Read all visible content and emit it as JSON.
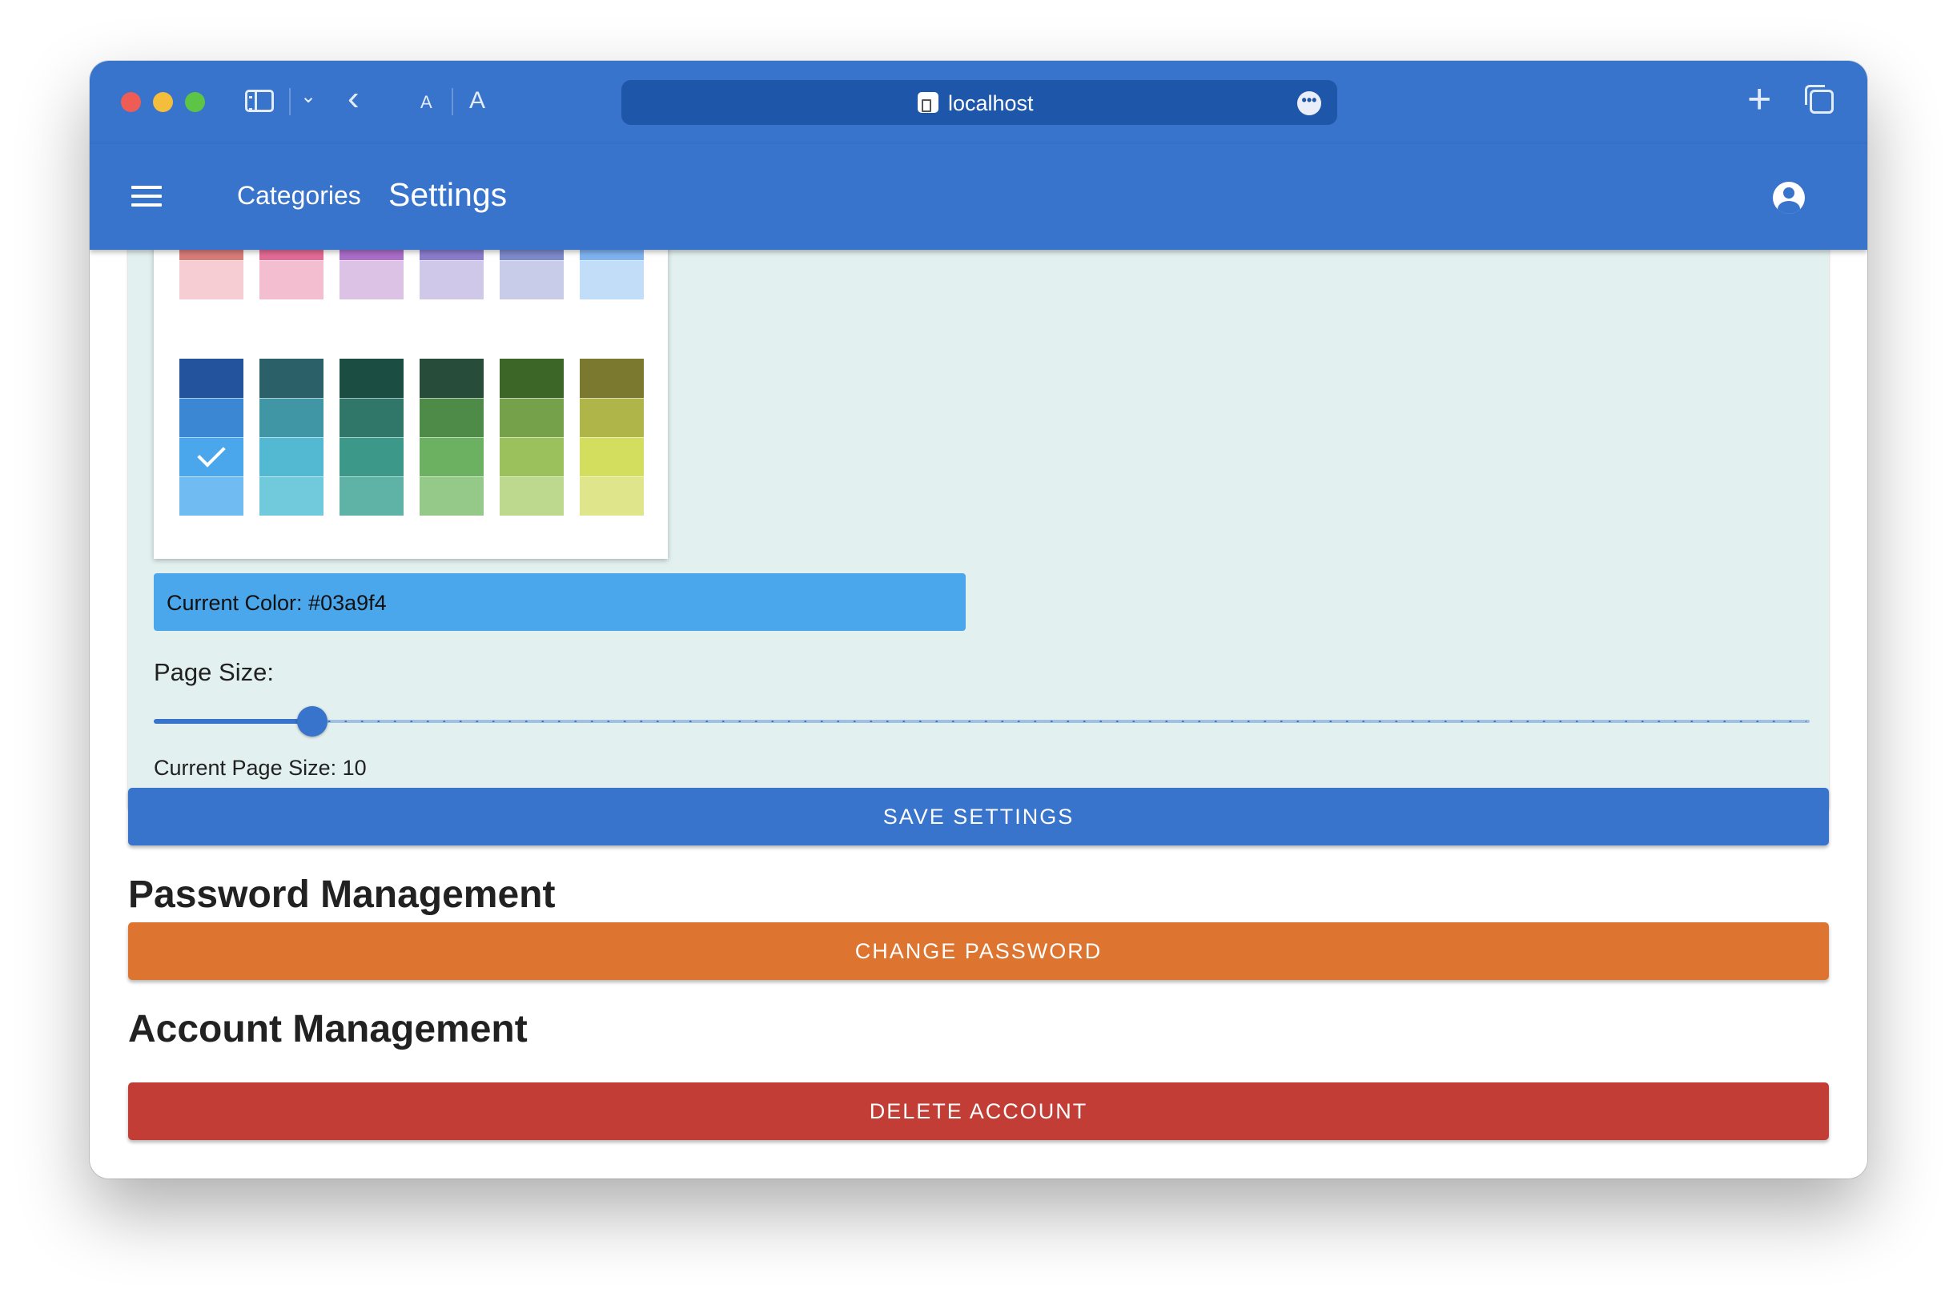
{
  "browser": {
    "address": "localhost",
    "font_small": "A",
    "font_large": "A",
    "more": "•••"
  },
  "app_bar": {
    "nav_categories": "Categories",
    "nav_settings": "Settings"
  },
  "settings": {
    "current_color_label": "Current Color: #03a9f4",
    "selected_color": "#03a9f4",
    "page_size_label": "Page Size:",
    "current_page_size_label": "Current Page Size: 10",
    "page_size_value": 10,
    "page_size_max": 100
  },
  "palette": {
    "top_group": [
      [
        "#d6423c",
        "#d87c78",
        "#f6cdd3"
      ],
      [
        "#c6305a",
        "#e26b95",
        "#f2bed0"
      ],
      [
        "#7b2b9e",
        "#aa6dc8",
        "#dcc3e6"
      ],
      [
        "#5a3aa8",
        "#8b7ccb",
        "#d0c8e8"
      ],
      [
        "#3b4ea4",
        "#7c89ca",
        "#c8cce8"
      ],
      [
        "#3a86dc",
        "#7eb3f0",
        "#c2ddf7"
      ]
    ],
    "bottom_group": [
      [
        "#23539c",
        "#3b87d4",
        "#4ba7ec",
        "#70bcf2"
      ],
      [
        "#2b6068",
        "#4196a6",
        "#53b8d2",
        "#70cadc"
      ],
      [
        "#1c4d42",
        "#30776a",
        "#3c9888",
        "#5fb3a6"
      ],
      [
        "#284c3a",
        "#4e8b48",
        "#6cb062",
        "#95c98a"
      ],
      [
        "#3b6628",
        "#74a14a",
        "#9bc15c",
        "#bcd98e"
      ],
      [
        "#7b7830",
        "#afb548",
        "#d4de5e",
        "#dfe58b"
      ]
    ],
    "selected_column": 0,
    "selected_row": 2
  },
  "password": {
    "heading": "Password Management",
    "button_label": "CHANGE PASSWORD"
  },
  "account": {
    "heading": "Account Management",
    "button_label": "DELETE ACCOUNT"
  },
  "actions": {
    "save_label": "SAVE SETTINGS"
  },
  "colors": {
    "primary": "#3873cc",
    "card_background": "#e2f0ef",
    "warning": "#dd742f",
    "danger": "#c23d35"
  }
}
